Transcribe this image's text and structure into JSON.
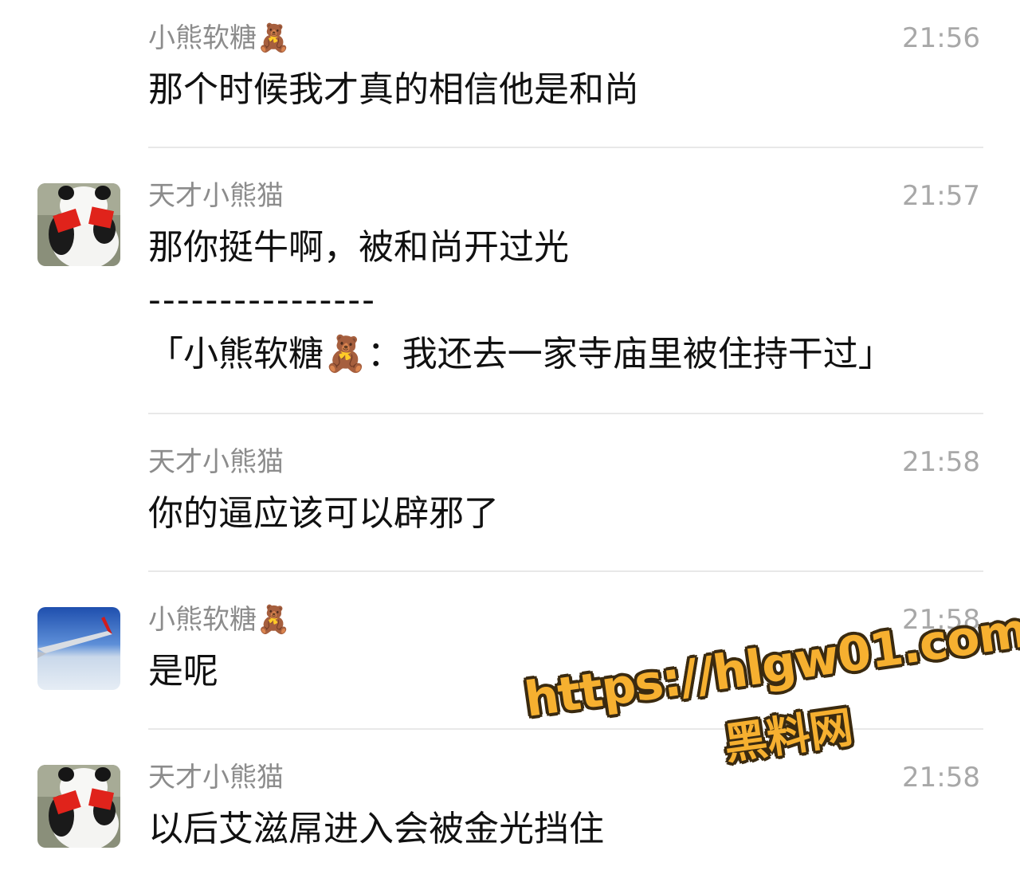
{
  "messages": [
    {
      "sender": "小熊软糖🧸",
      "time": "21:56",
      "lines": [
        "那个时候我才真的相信他是和尚"
      ]
    },
    {
      "sender": "天才小熊猫",
      "time": "21:57",
      "avatar": "panda-avatar",
      "lines": [
        "那你挺牛啊，被和尚开过光",
        "----------------",
        "「小熊软糖🧸：我还去一家寺庙里被住持干过」"
      ]
    },
    {
      "sender": "天才小熊猫",
      "time": "21:58",
      "lines": [
        "你的逼应该可以辟邪了"
      ]
    },
    {
      "sender": "小熊软糖🧸",
      "time": "21:58",
      "avatar": "airplane-wing-avatar",
      "lines": [
        "是呢"
      ]
    },
    {
      "sender": "天才小熊猫",
      "time": "21:58",
      "avatar": "panda-avatar",
      "lines": [
        "以后艾滋屌进入会被金光挡住"
      ]
    }
  ],
  "watermark": {
    "url": "https://hlgw01.com",
    "name": "黑料网"
  },
  "colors": {
    "sender": "#8c8c8c",
    "time": "#a8a8a8",
    "text": "#111111",
    "divider": "#e8e8e8",
    "watermark_fill": "#f6b030",
    "watermark_outline": "#3a2a10"
  }
}
